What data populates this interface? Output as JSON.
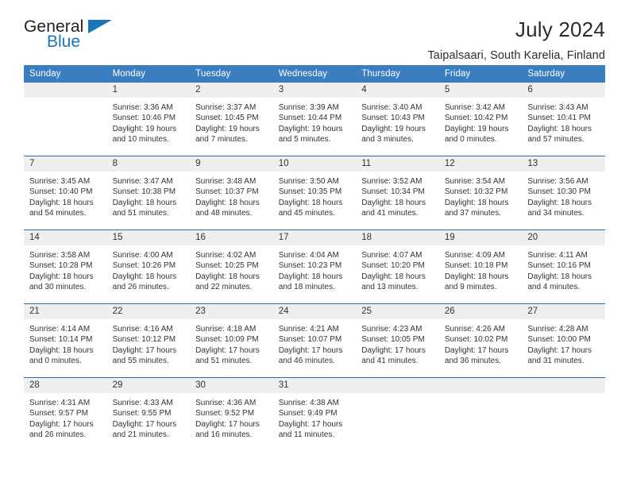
{
  "brand": {
    "name_part1": "General",
    "name_part2": "Blue",
    "accent_color": "#1b75bb"
  },
  "header": {
    "title": "July 2024",
    "subtitle": "Taipalsaari, South Karelia, Finland"
  },
  "theme": {
    "header_row_bg": "#3b7ebf",
    "day_band_bg": "#efefef",
    "grid_line": "#2f6ea5",
    "text": "#333333"
  },
  "weekdays": [
    "Sunday",
    "Monday",
    "Tuesday",
    "Wednesday",
    "Thursday",
    "Friday",
    "Saturday"
  ],
  "labels": {
    "sunrise": "Sunrise:",
    "sunset": "Sunset:",
    "daylight": "Daylight:"
  },
  "weeks": [
    [
      {
        "day": "",
        "lines": []
      },
      {
        "day": "1",
        "lines": [
          "Sunrise: 3:36 AM",
          "Sunset: 10:46 PM",
          "Daylight: 19 hours",
          "and 10 minutes."
        ]
      },
      {
        "day": "2",
        "lines": [
          "Sunrise: 3:37 AM",
          "Sunset: 10:45 PM",
          "Daylight: 19 hours",
          "and 7 minutes."
        ]
      },
      {
        "day": "3",
        "lines": [
          "Sunrise: 3:39 AM",
          "Sunset: 10:44 PM",
          "Daylight: 19 hours",
          "and 5 minutes."
        ]
      },
      {
        "day": "4",
        "lines": [
          "Sunrise: 3:40 AM",
          "Sunset: 10:43 PM",
          "Daylight: 19 hours",
          "and 3 minutes."
        ]
      },
      {
        "day": "5",
        "lines": [
          "Sunrise: 3:42 AM",
          "Sunset: 10:42 PM",
          "Daylight: 19 hours",
          "and 0 minutes."
        ]
      },
      {
        "day": "6",
        "lines": [
          "Sunrise: 3:43 AM",
          "Sunset: 10:41 PM",
          "Daylight: 18 hours",
          "and 57 minutes."
        ]
      }
    ],
    [
      {
        "day": "7",
        "lines": [
          "Sunrise: 3:45 AM",
          "Sunset: 10:40 PM",
          "Daylight: 18 hours",
          "and 54 minutes."
        ]
      },
      {
        "day": "8",
        "lines": [
          "Sunrise: 3:47 AM",
          "Sunset: 10:38 PM",
          "Daylight: 18 hours",
          "and 51 minutes."
        ]
      },
      {
        "day": "9",
        "lines": [
          "Sunrise: 3:48 AM",
          "Sunset: 10:37 PM",
          "Daylight: 18 hours",
          "and 48 minutes."
        ]
      },
      {
        "day": "10",
        "lines": [
          "Sunrise: 3:50 AM",
          "Sunset: 10:35 PM",
          "Daylight: 18 hours",
          "and 45 minutes."
        ]
      },
      {
        "day": "11",
        "lines": [
          "Sunrise: 3:52 AM",
          "Sunset: 10:34 PM",
          "Daylight: 18 hours",
          "and 41 minutes."
        ]
      },
      {
        "day": "12",
        "lines": [
          "Sunrise: 3:54 AM",
          "Sunset: 10:32 PM",
          "Daylight: 18 hours",
          "and 37 minutes."
        ]
      },
      {
        "day": "13",
        "lines": [
          "Sunrise: 3:56 AM",
          "Sunset: 10:30 PM",
          "Daylight: 18 hours",
          "and 34 minutes."
        ]
      }
    ],
    [
      {
        "day": "14",
        "lines": [
          "Sunrise: 3:58 AM",
          "Sunset: 10:28 PM",
          "Daylight: 18 hours",
          "and 30 minutes."
        ]
      },
      {
        "day": "15",
        "lines": [
          "Sunrise: 4:00 AM",
          "Sunset: 10:26 PM",
          "Daylight: 18 hours",
          "and 26 minutes."
        ]
      },
      {
        "day": "16",
        "lines": [
          "Sunrise: 4:02 AM",
          "Sunset: 10:25 PM",
          "Daylight: 18 hours",
          "and 22 minutes."
        ]
      },
      {
        "day": "17",
        "lines": [
          "Sunrise: 4:04 AM",
          "Sunset: 10:23 PM",
          "Daylight: 18 hours",
          "and 18 minutes."
        ]
      },
      {
        "day": "18",
        "lines": [
          "Sunrise: 4:07 AM",
          "Sunset: 10:20 PM",
          "Daylight: 18 hours",
          "and 13 minutes."
        ]
      },
      {
        "day": "19",
        "lines": [
          "Sunrise: 4:09 AM",
          "Sunset: 10:18 PM",
          "Daylight: 18 hours",
          "and 9 minutes."
        ]
      },
      {
        "day": "20",
        "lines": [
          "Sunrise: 4:11 AM",
          "Sunset: 10:16 PM",
          "Daylight: 18 hours",
          "and 4 minutes."
        ]
      }
    ],
    [
      {
        "day": "21",
        "lines": [
          "Sunrise: 4:14 AM",
          "Sunset: 10:14 PM",
          "Daylight: 18 hours",
          "and 0 minutes."
        ]
      },
      {
        "day": "22",
        "lines": [
          "Sunrise: 4:16 AM",
          "Sunset: 10:12 PM",
          "Daylight: 17 hours",
          "and 55 minutes."
        ]
      },
      {
        "day": "23",
        "lines": [
          "Sunrise: 4:18 AM",
          "Sunset: 10:09 PM",
          "Daylight: 17 hours",
          "and 51 minutes."
        ]
      },
      {
        "day": "24",
        "lines": [
          "Sunrise: 4:21 AM",
          "Sunset: 10:07 PM",
          "Daylight: 17 hours",
          "and 46 minutes."
        ]
      },
      {
        "day": "25",
        "lines": [
          "Sunrise: 4:23 AM",
          "Sunset: 10:05 PM",
          "Daylight: 17 hours",
          "and 41 minutes."
        ]
      },
      {
        "day": "26",
        "lines": [
          "Sunrise: 4:26 AM",
          "Sunset: 10:02 PM",
          "Daylight: 17 hours",
          "and 36 minutes."
        ]
      },
      {
        "day": "27",
        "lines": [
          "Sunrise: 4:28 AM",
          "Sunset: 10:00 PM",
          "Daylight: 17 hours",
          "and 31 minutes."
        ]
      }
    ],
    [
      {
        "day": "28",
        "lines": [
          "Sunrise: 4:31 AM",
          "Sunset: 9:57 PM",
          "Daylight: 17 hours",
          "and 26 minutes."
        ]
      },
      {
        "day": "29",
        "lines": [
          "Sunrise: 4:33 AM",
          "Sunset: 9:55 PM",
          "Daylight: 17 hours",
          "and 21 minutes."
        ]
      },
      {
        "day": "30",
        "lines": [
          "Sunrise: 4:36 AM",
          "Sunset: 9:52 PM",
          "Daylight: 17 hours",
          "and 16 minutes."
        ]
      },
      {
        "day": "31",
        "lines": [
          "Sunrise: 4:38 AM",
          "Sunset: 9:49 PM",
          "Daylight: 17 hours",
          "and 11 minutes."
        ]
      },
      {
        "day": "",
        "lines": []
      },
      {
        "day": "",
        "lines": []
      },
      {
        "day": "",
        "lines": []
      }
    ]
  ]
}
